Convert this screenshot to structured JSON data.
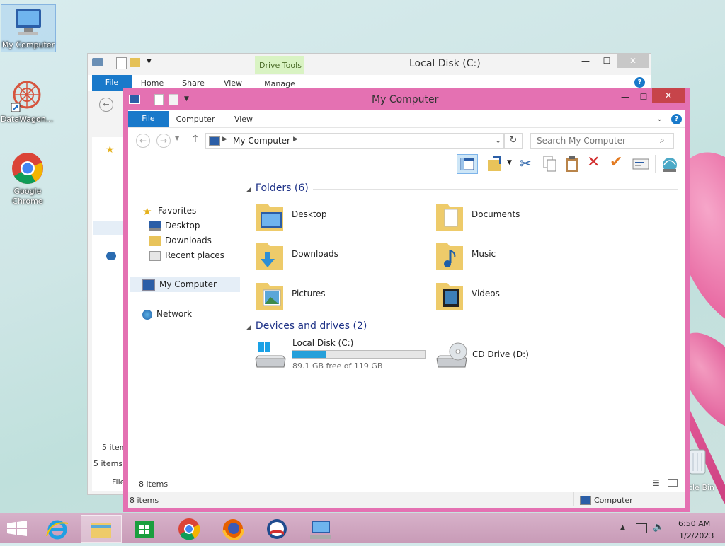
{
  "desktop": {
    "icons": [
      {
        "label": "My Computer"
      },
      {
        "label": "DataWagon..."
      },
      {
        "label": "Google Chrome"
      }
    ],
    "recycle_label": "cle Bin"
  },
  "back_window": {
    "title": "Local Disk (C:)",
    "context_tab_group": "Drive Tools",
    "tabs": [
      "File",
      "Home",
      "Share",
      "View",
      "Manage"
    ],
    "status_items_partial": "5 item",
    "status_items": "5 items",
    "file_partial": "File"
  },
  "front_window": {
    "title": "My Computer",
    "tabs": [
      "File",
      "Computer",
      "View"
    ],
    "address": {
      "root": "My Computer"
    },
    "search": {
      "placeholder": "Search My Computer"
    },
    "nav": {
      "favorites": "Favorites",
      "desktop": "Desktop",
      "downloads": "Downloads",
      "recent": "Recent places",
      "computer": "My Computer",
      "network": "Network"
    },
    "folders_header": "Folders (6)",
    "folders": [
      "Desktop",
      "Documents",
      "Downloads",
      "Music",
      "Pictures",
      "Videos"
    ],
    "devices_header": "Devices and drives (2)",
    "drives": {
      "c_label": "Local Disk (C:)",
      "c_free": "89.1 GB free of 119 GB",
      "c_used_fraction": 0.25,
      "d_label": "CD Drive (D:)"
    },
    "inner_status": "8 items",
    "status_items": "8 items",
    "status_location": "Computer"
  },
  "taskbar": {
    "time": "6:50 AM",
    "date": "1/2/2023"
  },
  "colors": {
    "accent": "#1979ca",
    "window_frame": "#e471b2",
    "close_button": "#c7444a",
    "section_text": "#1e3287",
    "progress": "#26a0da"
  }
}
